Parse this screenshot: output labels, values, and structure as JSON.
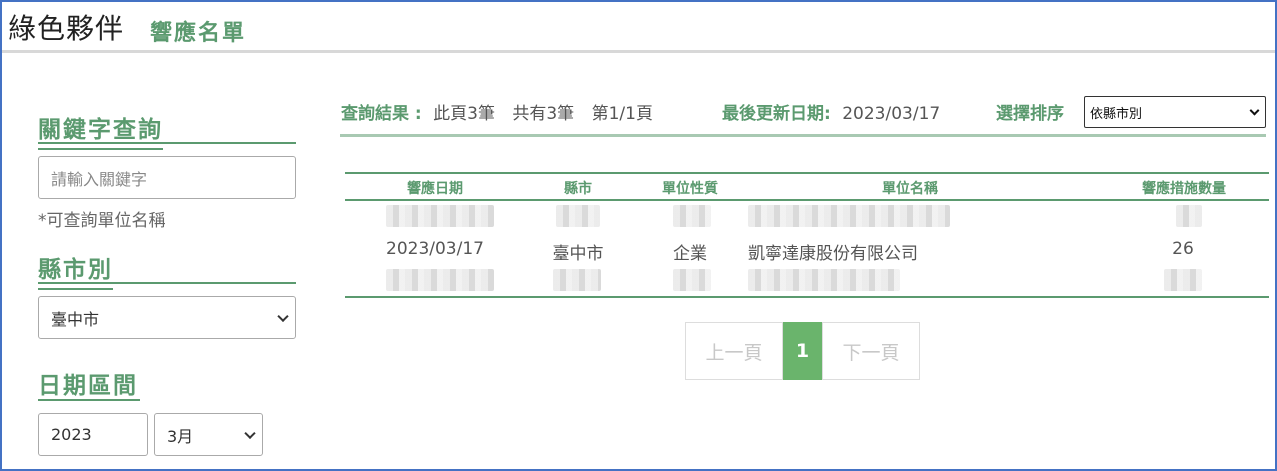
{
  "header": {
    "site_title": "綠色夥伴",
    "page_subtitle": "響應名單"
  },
  "sidebar": {
    "keyword": {
      "heading": "關鍵字查詢",
      "placeholder": "請輸入關鍵字",
      "hint": "*可查詢單位名稱"
    },
    "county": {
      "heading": "縣市別",
      "selected": "臺中市"
    },
    "date_range": {
      "heading": "日期區間",
      "year": "2023",
      "month": "3月"
    }
  },
  "summary": {
    "label": "查詢結果 :",
    "page_count": "此頁3筆",
    "total_count": "共有3筆",
    "page_of": "第1/1頁",
    "updated_label": "最後更新日期:",
    "updated_date": "2023/03/17",
    "sort_label": "選擇排序",
    "sort_selected": "依縣市別"
  },
  "table": {
    "columns": [
      "響應日期",
      "縣市",
      "單位性質",
      "單位名稱",
      "響應措施數量"
    ],
    "visible_row": {
      "date": "2023/03/17",
      "county": "臺中市",
      "type": "企業",
      "name": "凱寧達康股份有限公司",
      "count": "26"
    }
  },
  "pagination": {
    "prev": "上一頁",
    "current": "1",
    "next": "下一頁"
  },
  "colors": {
    "accent_green": "#5b9a6f",
    "active_page": "#6ab46c",
    "frame_border": "#4472c4"
  }
}
